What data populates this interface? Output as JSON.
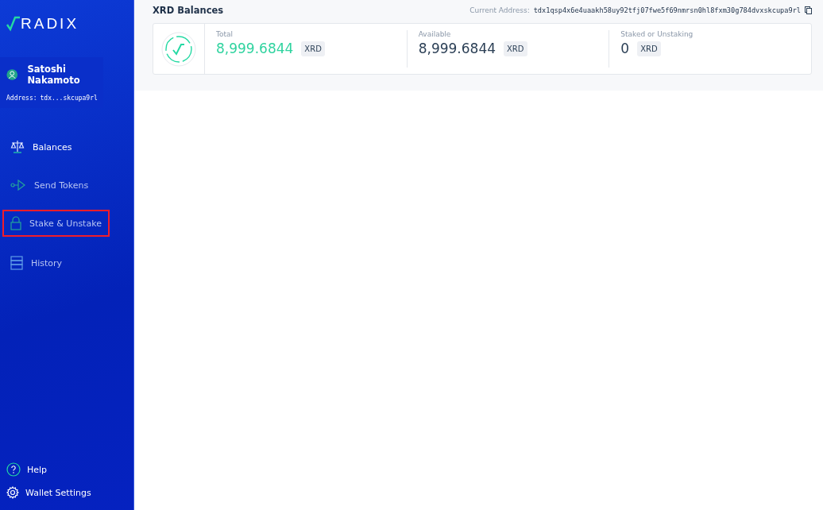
{
  "sidebar": {
    "logo": "RADIX",
    "user": {
      "name": "Satoshi Nakamoto",
      "address_label": "Address:",
      "address": "tdx...skcupa9rl"
    },
    "nav": [
      {
        "kind": "scale",
        "label": "Balances",
        "selected": true,
        "highlighted": false
      },
      {
        "kind": "send",
        "label": "Send Tokens",
        "selected": false,
        "highlighted": false
      },
      {
        "kind": "lock",
        "label": "Stake & Unstake",
        "selected": false,
        "highlighted": true
      },
      {
        "kind": "history",
        "label": "History",
        "selected": false,
        "highlighted": false
      }
    ],
    "footer": [
      {
        "kind": "help",
        "label": "Help"
      },
      {
        "kind": "settings",
        "label": "Wallet Settings"
      }
    ]
  },
  "header": {
    "title": "XRD Balances",
    "address_label": "Current Address:",
    "address": "tdx1qsp4x6e4uaakh58uy92tfj07fwe5f69nmrsn0hl8fxm30g784dvxskcupa9rl"
  },
  "balances": [
    {
      "label": "Total",
      "amount": "8,999.6844",
      "unit": "XRD",
      "accent": true
    },
    {
      "label": "Available",
      "amount": "8,999.6844",
      "unit": "XRD",
      "accent": false
    },
    {
      "label": "Staked or Unstaking",
      "amount": "0",
      "unit": "XRD",
      "accent": false
    }
  ]
}
